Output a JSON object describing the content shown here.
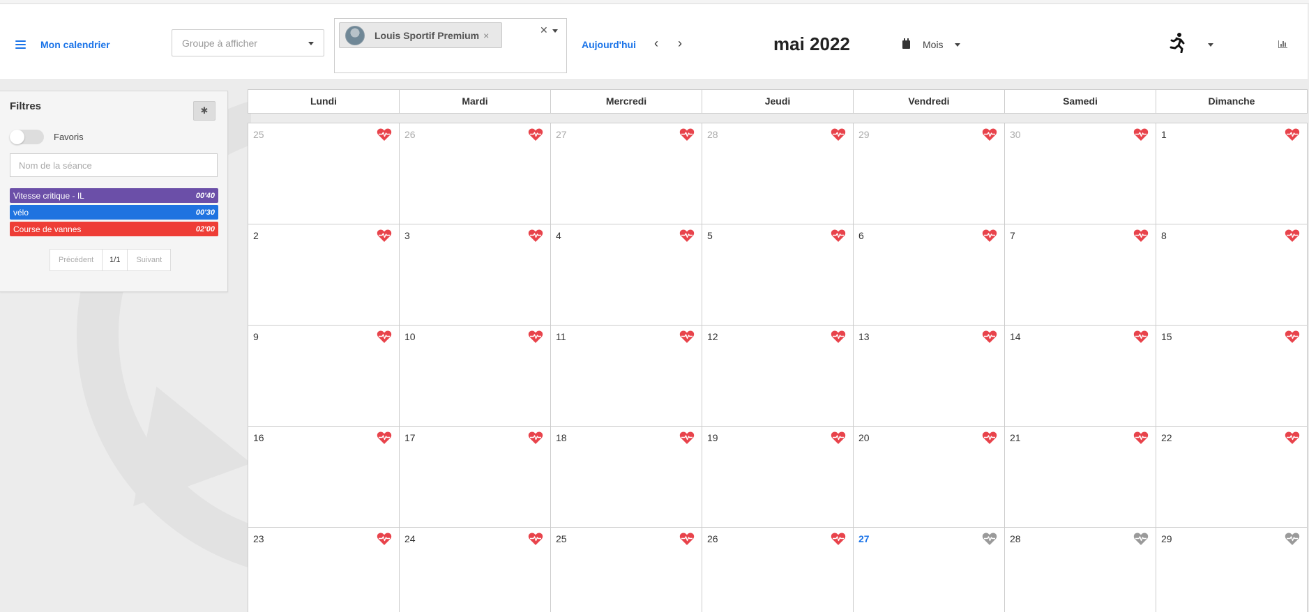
{
  "header": {
    "app_title": "Mon calendrier",
    "group_placeholder": "Groupe à afficher",
    "athlete_name": "Louis Sportif Premium",
    "today_label": "Aujourd'hui",
    "month_title": "mai 2022",
    "view_label": "Mois",
    "icons": {
      "menu": "hamburger-icon",
      "calendar": "calendar-icon",
      "sport": "running-icon",
      "stats": "bar-chart-icon"
    }
  },
  "filters": {
    "title": "Filtres",
    "favorites_label": "Favoris",
    "favorites_on": false,
    "seance_placeholder": "Nom de la séance",
    "sessions": [
      {
        "name": "Vitesse critique - IL",
        "duration": "00'40",
        "color": "#6b4fa8"
      },
      {
        "name": "vélo",
        "duration": "00'30",
        "color": "#1f73e0"
      },
      {
        "name": "Course de vannes",
        "duration": "02'00",
        "color": "#ee3d36"
      }
    ],
    "pager": {
      "prev": "Précédent",
      "page": "1/1",
      "next": "Suivant"
    }
  },
  "calendar": {
    "weekdays": [
      "Lundi",
      "Mardi",
      "Mercredi",
      "Jeudi",
      "Vendredi",
      "Samedi",
      "Dimanche"
    ],
    "days": [
      {
        "n": "25",
        "state": "other",
        "heart": "red"
      },
      {
        "n": "26",
        "state": "other",
        "heart": "red"
      },
      {
        "n": "27",
        "state": "other",
        "heart": "red"
      },
      {
        "n": "28",
        "state": "other",
        "heart": "red"
      },
      {
        "n": "29",
        "state": "other",
        "heart": "red"
      },
      {
        "n": "30",
        "state": "other",
        "heart": "red"
      },
      {
        "n": "1",
        "state": "current",
        "heart": "red"
      },
      {
        "n": "2",
        "state": "current",
        "heart": "red"
      },
      {
        "n": "3",
        "state": "current",
        "heart": "red"
      },
      {
        "n": "4",
        "state": "current",
        "heart": "red"
      },
      {
        "n": "5",
        "state": "current",
        "heart": "red"
      },
      {
        "n": "6",
        "state": "current",
        "heart": "red"
      },
      {
        "n": "7",
        "state": "current",
        "heart": "red"
      },
      {
        "n": "8",
        "state": "current",
        "heart": "red"
      },
      {
        "n": "9",
        "state": "current",
        "heart": "red"
      },
      {
        "n": "10",
        "state": "current",
        "heart": "red"
      },
      {
        "n": "11",
        "state": "current",
        "heart": "red"
      },
      {
        "n": "12",
        "state": "current",
        "heart": "red"
      },
      {
        "n": "13",
        "state": "current",
        "heart": "red"
      },
      {
        "n": "14",
        "state": "current",
        "heart": "red"
      },
      {
        "n": "15",
        "state": "current",
        "heart": "red"
      },
      {
        "n": "16",
        "state": "current",
        "heart": "red"
      },
      {
        "n": "17",
        "state": "current",
        "heart": "red"
      },
      {
        "n": "18",
        "state": "current",
        "heart": "red"
      },
      {
        "n": "19",
        "state": "current",
        "heart": "red"
      },
      {
        "n": "20",
        "state": "current",
        "heart": "red"
      },
      {
        "n": "21",
        "state": "current",
        "heart": "red"
      },
      {
        "n": "22",
        "state": "current",
        "heart": "red"
      },
      {
        "n": "23",
        "state": "current",
        "heart": "red"
      },
      {
        "n": "24",
        "state": "current",
        "heart": "red"
      },
      {
        "n": "25",
        "state": "current",
        "heart": "red"
      },
      {
        "n": "26",
        "state": "current",
        "heart": "red"
      },
      {
        "n": "27",
        "state": "today",
        "heart": "grey"
      },
      {
        "n": "28",
        "state": "current",
        "heart": "grey"
      },
      {
        "n": "29",
        "state": "current",
        "heart": "grey"
      }
    ],
    "heart_colors": {
      "red": "#e8434b",
      "grey": "#9a9a9a"
    }
  }
}
